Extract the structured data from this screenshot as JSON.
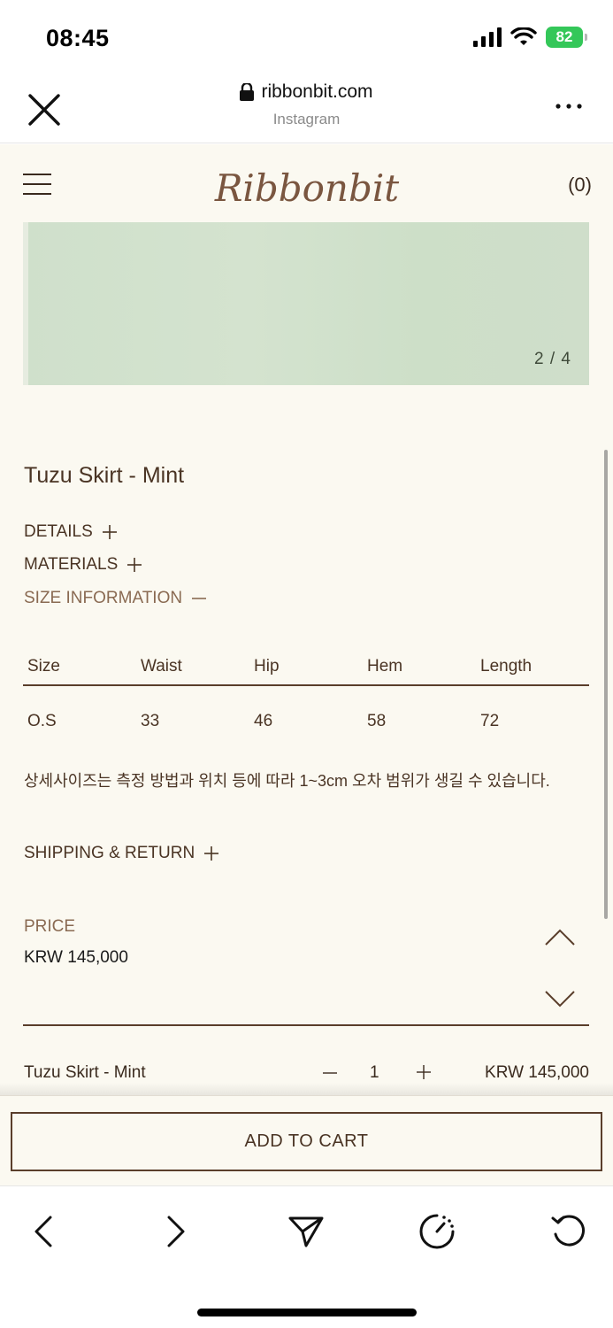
{
  "status_bar": {
    "time": "08:45",
    "battery": "82"
  },
  "browser": {
    "domain": "ribbonbit.com",
    "source": "Instagram"
  },
  "site": {
    "logo": "Ribbonbit",
    "cart_count": "(0)"
  },
  "gallery": {
    "counter": "2 / 4"
  },
  "product": {
    "title": "Tuzu Skirt - Mint"
  },
  "sections": {
    "details": "DETAILS",
    "materials": "MATERIALS",
    "size_information": "SIZE INFORMATION",
    "shipping_return": "SHIPPING & RETURN"
  },
  "size_table": {
    "headers": [
      "Size",
      "Waist",
      "Hip",
      "Hem",
      "Length"
    ],
    "rows": [
      [
        "O.S",
        "33",
        "46",
        "58",
        "72"
      ]
    ],
    "note": "상세사이즈는 측정 방법과 위치 등에 따라 1~3cm 오차 범위가 생길 수 있습니다."
  },
  "price": {
    "label": "PRICE",
    "value": "KRW 145,000"
  },
  "line_item": {
    "name": "Tuzu Skirt - Mint",
    "quantity": "1",
    "price": "KRW 145,000"
  },
  "cta": {
    "add_to_cart": "ADD TO CART"
  },
  "colors": {
    "brand_brown": "#5a3e2b",
    "page_bg": "#fbf9f1",
    "hero_mint": "#cfe0cb",
    "battery_green": "#34c759"
  }
}
